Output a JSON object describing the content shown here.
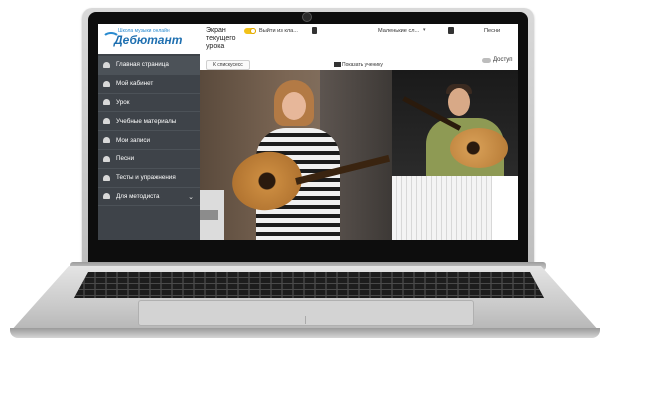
{
  "logo": {
    "tagline": "Школа музыки онлайн",
    "name": "Дебютант"
  },
  "sidebar": {
    "items": [
      {
        "label": "Главная страница",
        "icon": "home-icon",
        "active": true
      },
      {
        "label": "Мой кабинет",
        "icon": "user-icon",
        "active": false
      },
      {
        "label": "Урок",
        "icon": "lesson-icon",
        "active": false
      },
      {
        "label": "Учебные материалы",
        "icon": "book-icon",
        "active": false
      },
      {
        "label": "Мои записи",
        "icon": "notes-icon",
        "active": false
      },
      {
        "label": "Песни",
        "icon": "music-icon",
        "active": false
      },
      {
        "label": "Тесты и упражнения",
        "icon": "test-icon",
        "active": false
      },
      {
        "label": "Для методиста",
        "icon": "globe-icon",
        "active": false,
        "expandable": true
      }
    ]
  },
  "topbar": {
    "screen_title": "Экран текущего урока",
    "exit_label": "Выйти из кла...",
    "size_label": "Маленькие сл...",
    "songs_label": "Песни",
    "back_label": "К спискусеcc",
    "show_student_label": "Показать ученику",
    "access_label": "Доступ"
  },
  "colors": {
    "sidebar": "#3e4349",
    "accent": "#f2c21a",
    "logo": "#1e6fb0"
  }
}
